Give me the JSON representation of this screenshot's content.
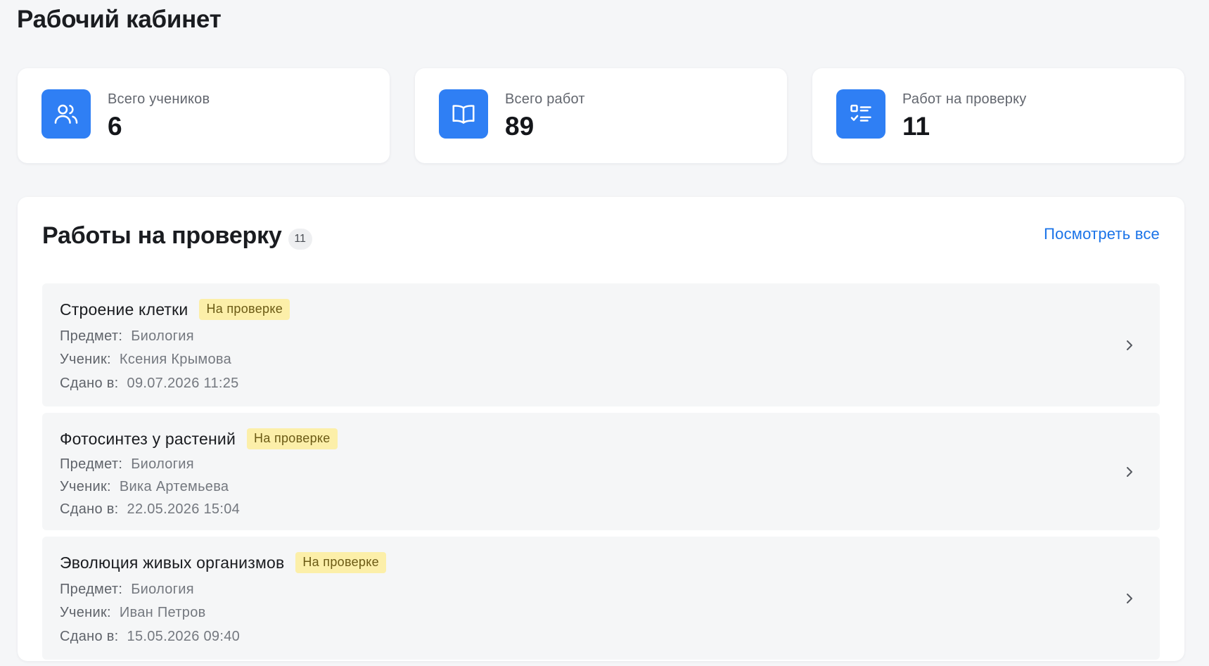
{
  "page": {
    "title": "Рабочий кабинет"
  },
  "stats": [
    {
      "label": "Всего учеников",
      "value": "6",
      "icon": "users-icon"
    },
    {
      "label": "Всего работ",
      "value": "89",
      "icon": "book-icon"
    },
    {
      "label": "Работ на проверку",
      "value": "11",
      "icon": "checklist-icon"
    }
  ],
  "review": {
    "title": "Работы на проверку",
    "count": "11",
    "view_all": "Посмотреть все",
    "subject_label": "Предмет:",
    "student_label": "Ученик:",
    "submitted_label": "Сдано в:",
    "items": [
      {
        "title": "Строение клетки",
        "status": "На проверке",
        "subject": "Биология",
        "student": "Ксения Крымова",
        "submitted": "09.07.2026 11:25"
      },
      {
        "title": "Фотосинтез у растений",
        "status": "На проверке",
        "subject": "Биология",
        "student": "Вика Артемьева",
        "submitted": "22.05.2026 15:04"
      },
      {
        "title": "Эволюция живых организмов",
        "status": "На проверке",
        "subject": "Биология",
        "student": "Иван Петров",
        "submitted": "15.05.2026 09:40"
      }
    ]
  },
  "colors": {
    "accent": "#2f7ff4",
    "link": "#1a73e8",
    "status_badge_bg": "#fcefa9",
    "background": "#f5f6f8"
  }
}
